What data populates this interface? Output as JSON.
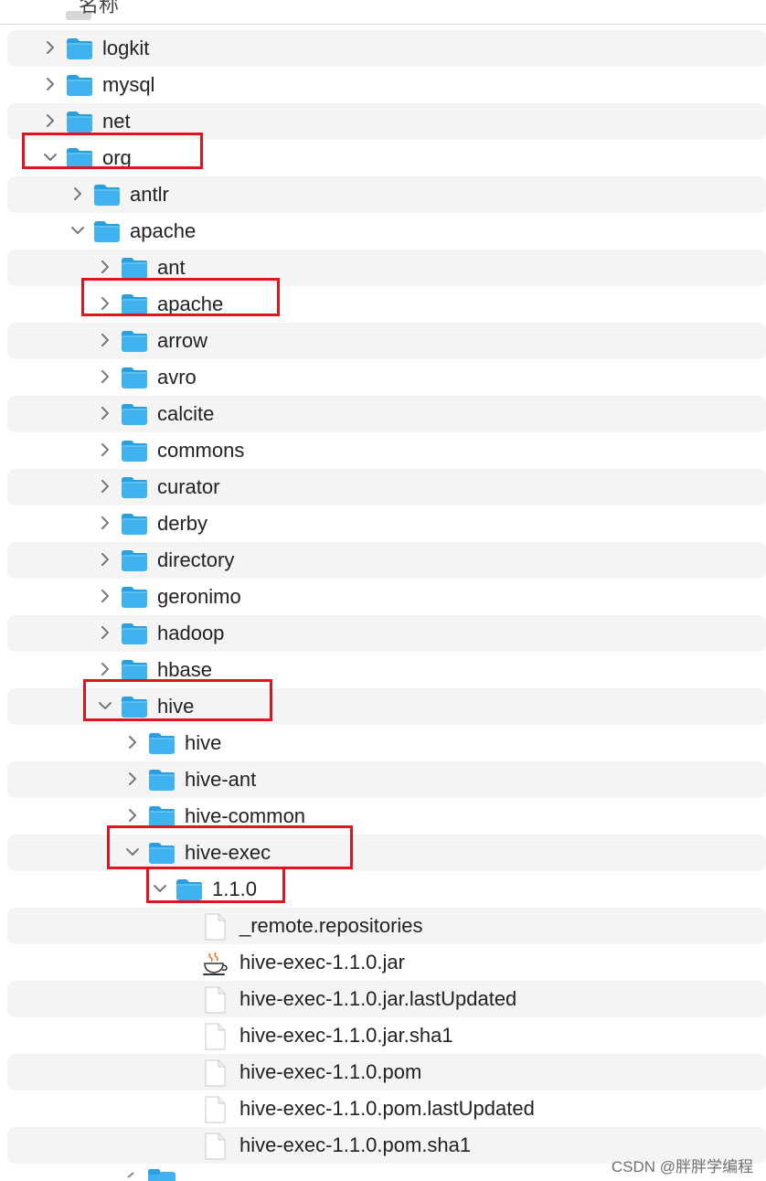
{
  "header": {
    "column_title": "名称"
  },
  "tree": [
    {
      "label": "logkit",
      "kind": "folder",
      "depth": 0,
      "expanded": false
    },
    {
      "label": "mysql",
      "kind": "folder",
      "depth": 0,
      "expanded": false
    },
    {
      "label": "net",
      "kind": "folder",
      "depth": 0,
      "expanded": false
    },
    {
      "label": "org",
      "kind": "folder",
      "depth": 0,
      "expanded": true,
      "highlighted": true
    },
    {
      "label": "antlr",
      "kind": "folder",
      "depth": 1,
      "expanded": false
    },
    {
      "label": "apache",
      "kind": "folder",
      "depth": 1,
      "expanded": true
    },
    {
      "label": "ant",
      "kind": "folder",
      "depth": 2,
      "expanded": false
    },
    {
      "label": "apache",
      "kind": "folder",
      "depth": 2,
      "expanded": false,
      "highlighted": true
    },
    {
      "label": "arrow",
      "kind": "folder",
      "depth": 2,
      "expanded": false
    },
    {
      "label": "avro",
      "kind": "folder",
      "depth": 2,
      "expanded": false
    },
    {
      "label": "calcite",
      "kind": "folder",
      "depth": 2,
      "expanded": false
    },
    {
      "label": "commons",
      "kind": "folder",
      "depth": 2,
      "expanded": false
    },
    {
      "label": "curator",
      "kind": "folder",
      "depth": 2,
      "expanded": false
    },
    {
      "label": "derby",
      "kind": "folder",
      "depth": 2,
      "expanded": false
    },
    {
      "label": "directory",
      "kind": "folder",
      "depth": 2,
      "expanded": false
    },
    {
      "label": "geronimo",
      "kind": "folder",
      "depth": 2,
      "expanded": false
    },
    {
      "label": "hadoop",
      "kind": "folder",
      "depth": 2,
      "expanded": false
    },
    {
      "label": "hbase",
      "kind": "folder",
      "depth": 2,
      "expanded": false
    },
    {
      "label": "hive",
      "kind": "folder",
      "depth": 2,
      "expanded": true,
      "highlighted": true
    },
    {
      "label": "hive",
      "kind": "folder",
      "depth": 3,
      "expanded": false
    },
    {
      "label": "hive-ant",
      "kind": "folder",
      "depth": 3,
      "expanded": false
    },
    {
      "label": "hive-common",
      "kind": "folder",
      "depth": 3,
      "expanded": false
    },
    {
      "label": "hive-exec",
      "kind": "folder",
      "depth": 3,
      "expanded": true,
      "highlighted": true
    },
    {
      "label": "1.1.0",
      "kind": "folder",
      "depth": 4,
      "expanded": true,
      "highlighted": true
    },
    {
      "label": "_remote.repositories",
      "kind": "file",
      "depth": 5
    },
    {
      "label": "hive-exec-1.1.0.jar",
      "kind": "jar",
      "depth": 5
    },
    {
      "label": "hive-exec-1.1.0.jar.lastUpdated",
      "kind": "file",
      "depth": 5
    },
    {
      "label": "hive-exec-1.1.0.jar.sha1",
      "kind": "file",
      "depth": 5
    },
    {
      "label": "hive-exec-1.1.0.pom",
      "kind": "file",
      "depth": 5
    },
    {
      "label": "hive-exec-1.1.0.pom.lastUpdated",
      "kind": "file",
      "depth": 5
    },
    {
      "label": "hive-exec-1.1.0.pom.sha1",
      "kind": "file",
      "depth": 5
    }
  ],
  "colors": {
    "folder_body": "#3fb2ef",
    "folder_tab": "#2a9fe0",
    "stripe": "#f4f4f4",
    "highlight_border": "#e0141e"
  },
  "watermark": "CSDN @胖胖学编程"
}
